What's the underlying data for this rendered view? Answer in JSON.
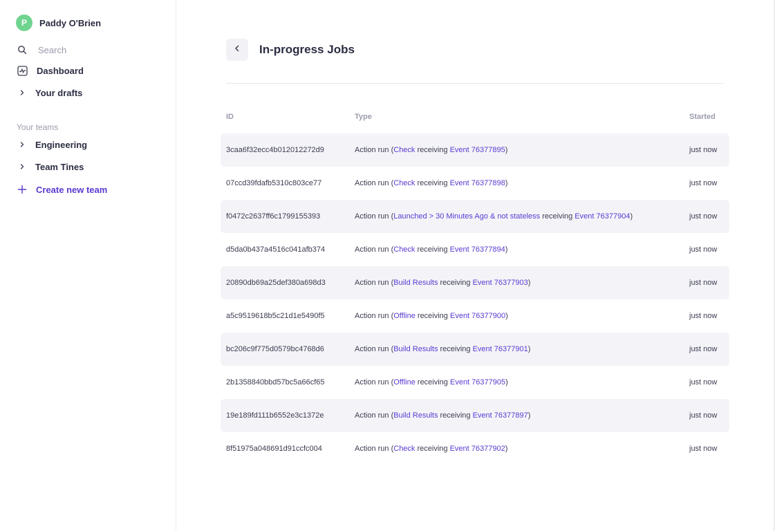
{
  "sidebar": {
    "user": {
      "initial": "P",
      "name": "Paddy O'Brien"
    },
    "search_placeholder": "Search",
    "dashboard_label": "Dashboard",
    "drafts_label": "Your drafts",
    "teams_heading": "Your teams",
    "teams": [
      "Engineering",
      "Team Tines"
    ],
    "create_team_label": "Create new team"
  },
  "main": {
    "title": "In-progress Jobs",
    "columns": {
      "id": "ID",
      "type": "Type",
      "started": "Started"
    },
    "rows": [
      {
        "id": "3caa6f32ecc4b012012272d9",
        "prefix": "Action run (",
        "action": "Check",
        "mid": " receiving ",
        "event": "Event 76377895",
        "suffix": ")",
        "started": "just now"
      },
      {
        "id": "07ccd39fdafb5310c803ce77",
        "prefix": "Action run (",
        "action": "Check",
        "mid": " receiving ",
        "event": "Event 76377898",
        "suffix": ")",
        "started": "just now"
      },
      {
        "id": "f0472c2637ff6c1799155393",
        "prefix": "Action run (",
        "action": "Launched > 30 Minutes Ago & not stateless",
        "mid": " receiving ",
        "event": "Event 76377904",
        "suffix": ")",
        "started": "just now"
      },
      {
        "id": "d5da0b437a4516c041afb374",
        "prefix": "Action run (",
        "action": "Check",
        "mid": " receiving ",
        "event": "Event 76377894",
        "suffix": ")",
        "started": "just now"
      },
      {
        "id": "20890db69a25def380a698d3",
        "prefix": "Action run (",
        "action": "Build Results",
        "mid": " receiving ",
        "event": "Event 76377903",
        "suffix": ")",
        "started": "just now"
      },
      {
        "id": "a5c9519618b5c21d1e5490f5",
        "prefix": "Action run (",
        "action": "Offline",
        "mid": " receiving ",
        "event": "Event 76377900",
        "suffix": ")",
        "started": "just now"
      },
      {
        "id": "bc206c9f775d0579bc4768d6",
        "prefix": "Action run (",
        "action": "Build Results",
        "mid": " receiving ",
        "event": "Event 76377901",
        "suffix": ")",
        "started": "just now"
      },
      {
        "id": "2b1358840bbd57bc5a66cf65",
        "prefix": "Action run (",
        "action": "Offline",
        "mid": " receiving ",
        "event": "Event 76377905",
        "suffix": ")",
        "started": "just now"
      },
      {
        "id": "19e189fd111b6552e3c1372e",
        "prefix": "Action run (",
        "action": "Build Results",
        "mid": " receiving ",
        "event": "Event 76377897",
        "suffix": ")",
        "started": "just now"
      },
      {
        "id": "8f51975a048691d91ccfc004",
        "prefix": "Action run (",
        "action": "Check",
        "mid": " receiving ",
        "event": "Event 76377902",
        "suffix": ")",
        "started": "just now"
      }
    ]
  },
  "colors": {
    "accent": "#5a39d1",
    "avatar": "#6fd48f",
    "row_stripe": "#f4f4f8"
  },
  "icons": {
    "search": "search-icon",
    "dashboard": "dashboard-icon",
    "chevron": "chevron-right-icon",
    "plus": "plus-icon",
    "back": "chevron-left-icon"
  }
}
